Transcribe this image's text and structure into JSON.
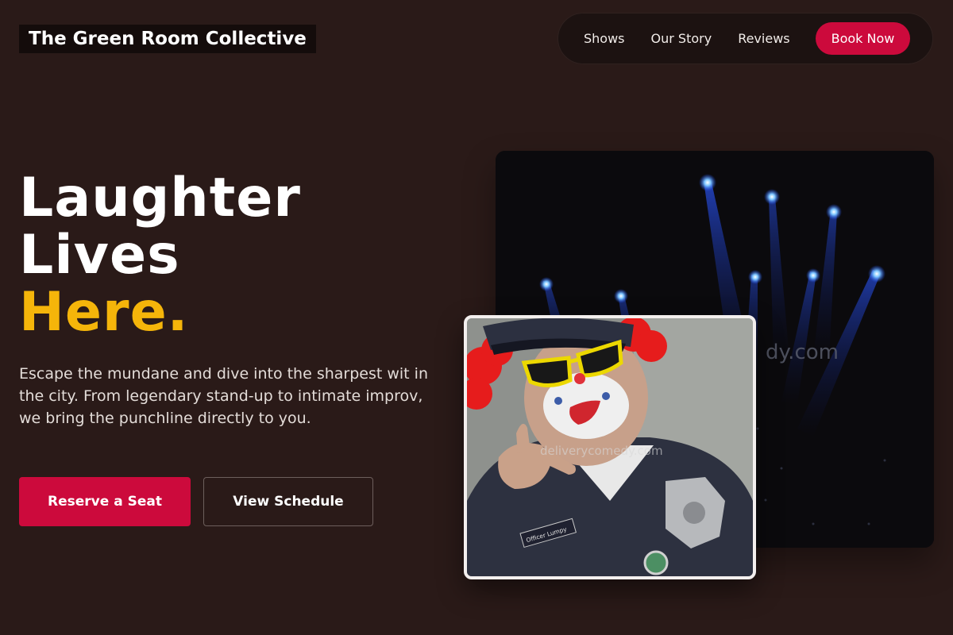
{
  "header": {
    "brand": "The Green Room Collective",
    "nav": {
      "links": [
        "Shows",
        "Our Story",
        "Reviews"
      ],
      "cta": "Book Now"
    }
  },
  "hero": {
    "headline": {
      "line1": "Laughter",
      "line2": "Lives",
      "line3": "Here."
    },
    "lead": "Escape the mundane and dive into the sharpest wit in the city. From legendary stand-up to intimate improv, we bring the punchline directly to you.",
    "primary_button": "Reserve a Seat",
    "secondary_button": "View Schedule"
  },
  "images": {
    "stage_watermark": "dy.com",
    "clown_watermark": "deliverycomedy.com",
    "name_tag": "Officer Lumpy"
  },
  "colors": {
    "background": "#2a1a18",
    "accent": "#cc0a3c",
    "highlight": "#f5b50a"
  }
}
